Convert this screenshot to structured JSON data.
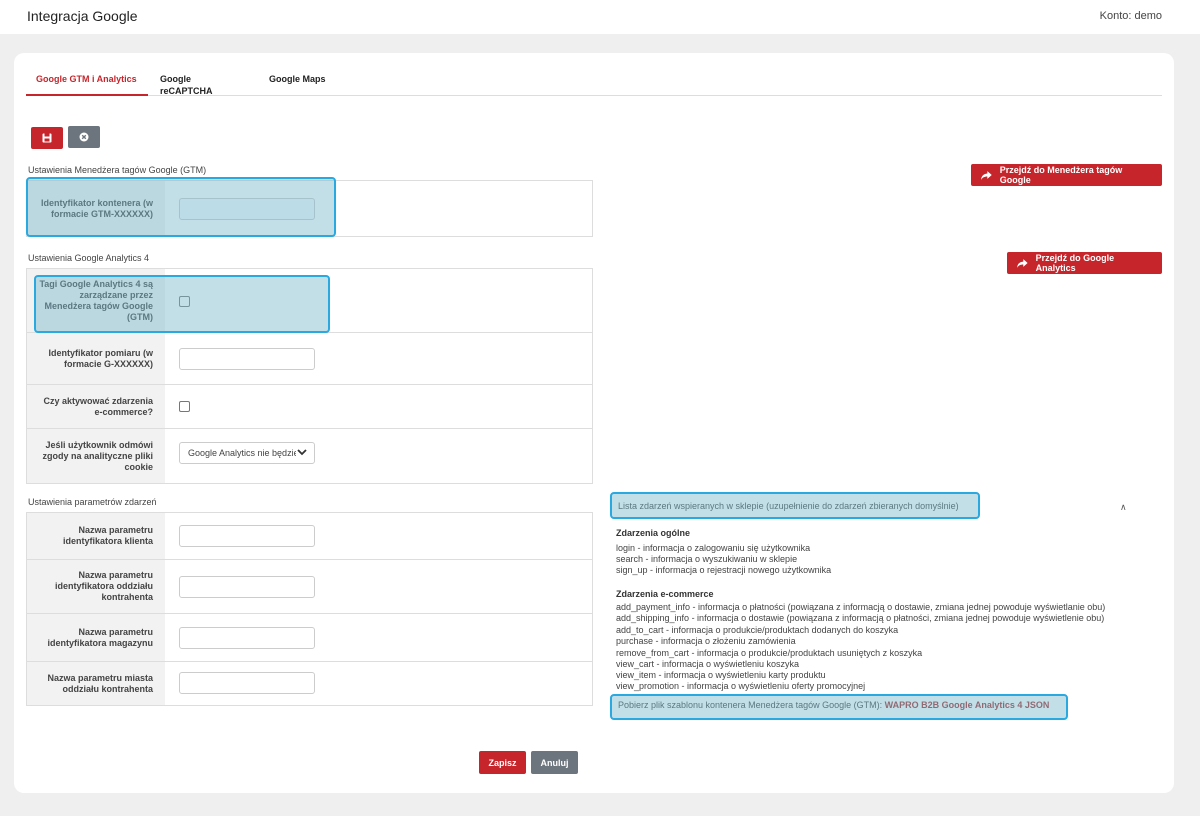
{
  "topbar": {
    "title": "Integracja Google",
    "account": "Konto: demo"
  },
  "tabs": [
    {
      "label": "Google GTM i Analytics",
      "active": true
    },
    {
      "label": "Google reCAPTCHA",
      "active": false
    },
    {
      "label": "Google Maps",
      "active": false
    }
  ],
  "toolbar": {
    "save_icon": "floppy-disk-icon",
    "cancel_icon": "close-circle-icon"
  },
  "gtm": {
    "section_label": "Ustawienia Menedżera tagów Google (GTM)",
    "container_id_label": "Identyfikator kontenera (w formacie GTM-XXXXXX)",
    "container_id_value": "",
    "goto_button": "Przejdź do Menedżera tagów Google"
  },
  "ga4": {
    "section_label": "Ustawienia Google Analytics 4",
    "managed_by_gtm_label": "Tagi Google Analytics 4 są zarządzane przez Menedżera tagów Google (GTM)",
    "managed_by_gtm_checked": false,
    "measurement_id_label": "Identyfikator pomiaru (w formacie G-XXXXXX)",
    "measurement_id_value": "",
    "ecommerce_label": "Czy aktywować zdarzenia e-commerce?",
    "ecommerce_checked": false,
    "consent_label": "Jeśli użytkownik odmówi zgody na analityczne pliki cookie",
    "consent_value": "Google Analytics nie będzie",
    "goto_button": "Przejdź do Google Analytics"
  },
  "params": {
    "section_label": "Ustawienia parametrów zdarzeń",
    "client_id_label": "Nazwa parametru identyfikatora klienta",
    "branch_id_label": "Nazwa parametru identyfikatora oddziału kontrahenta",
    "warehouse_id_label": "Nazwa parametru identyfikatora magazynu",
    "branch_city_label": "Nazwa parametru miasta oddziału kontrahenta"
  },
  "events": {
    "header": "Lista zdarzeń wspieranych w sklepie (uzupełnienie do zdarzeń zbieranych domyślnie)",
    "general_title": "Zdarzenia ogólne",
    "general": [
      "login - informacja o zalogowaniu się użytkownika",
      "search - informacja o wyszukiwaniu w sklepie",
      "sign_up - informacja o rejestracji nowego użytkownika"
    ],
    "ecommerce_title": "Zdarzenia e-commerce",
    "ecommerce": [
      "add_payment_info - informacja o płatności (powiązana z informacją o dostawie, zmiana jednej powoduje wyświetlanie obu)",
      "add_shipping_info - informacja o dostawie (powiązana z informacją o płatności, zmiana jednej powoduje wyświetlenie obu)",
      "add_to_cart - informacja o produkcie/produktach dodanych do koszyka",
      "purchase - informacja o złożeniu zamówienia",
      "remove_from_cart - informacja o produkcie/produktach usuniętych z koszyka",
      "view_cart - informacja o wyświetleniu koszyka",
      "view_item - informacja o wyświetleniu karty produktu",
      "view_promotion - informacja o wyświetleniu oferty promocyjnej"
    ],
    "download_text": "Pobierz plik szablonu kontenera Menedżera tagów Google (GTM):",
    "download_link": "WAPRO B2B Google Analytics 4 JSON"
  },
  "footer": {
    "save_label": "Zapisz",
    "cancel_label": "Anuluj"
  }
}
